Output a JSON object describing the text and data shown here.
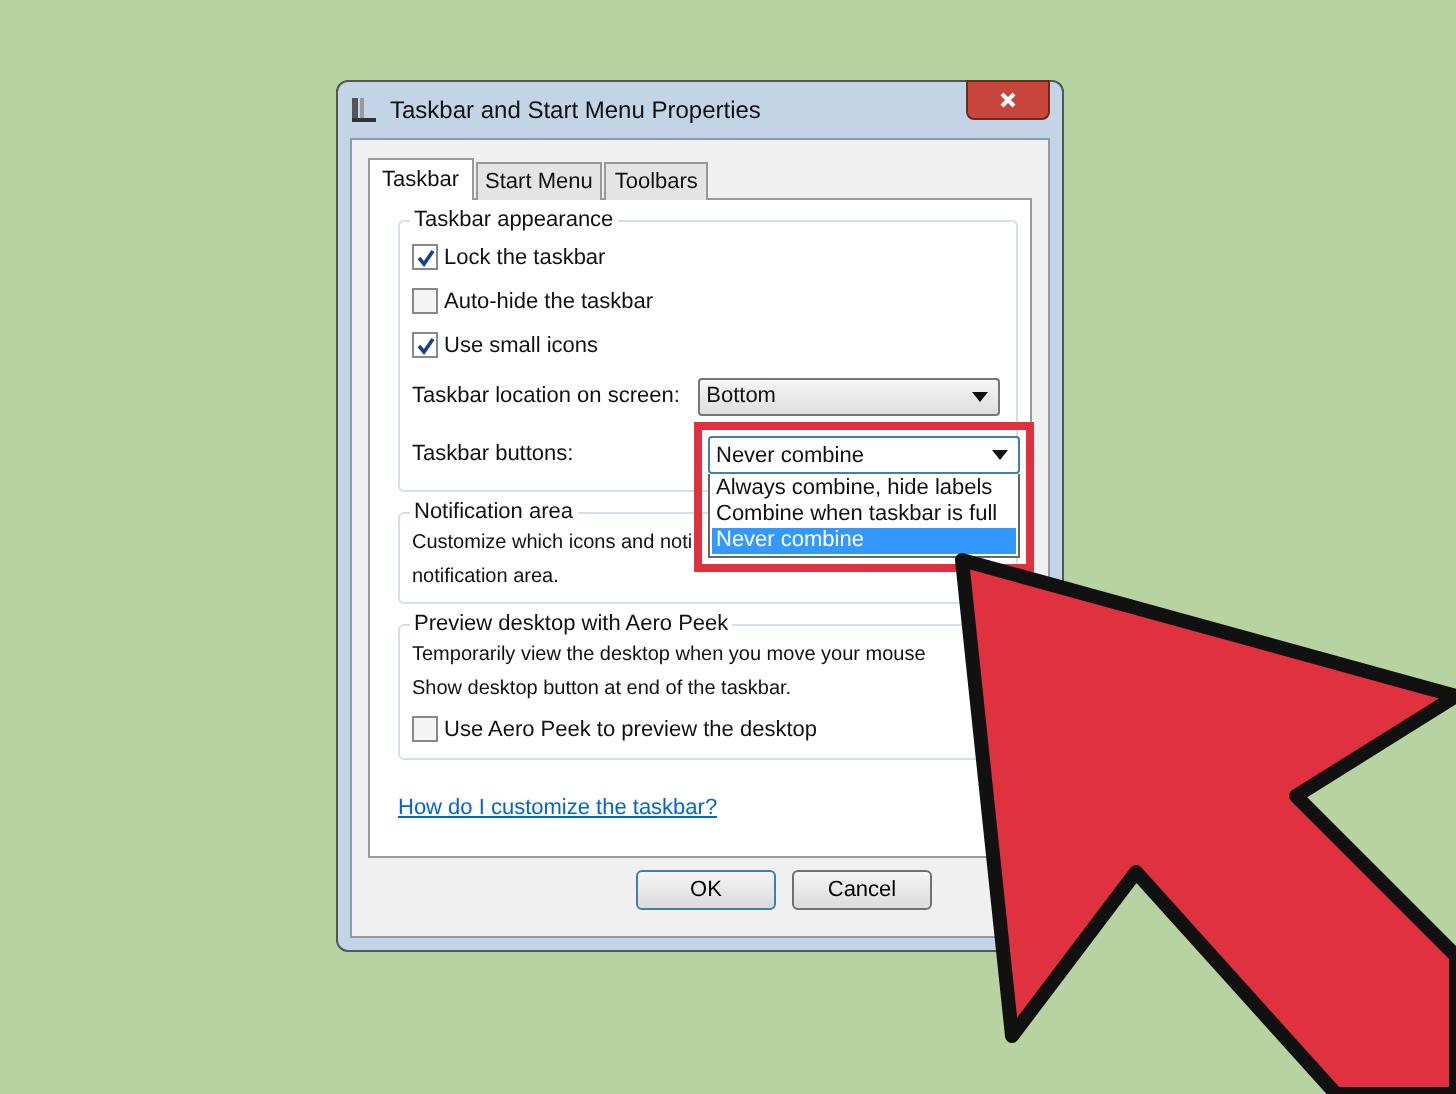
{
  "window": {
    "title": "Taskbar and Start Menu Properties"
  },
  "tabs": [
    {
      "label": "Taskbar",
      "selected": true
    },
    {
      "label": "Start Menu",
      "selected": false
    },
    {
      "label": "Toolbars",
      "selected": false
    }
  ],
  "appearance": {
    "title": "Taskbar appearance",
    "checkboxes": [
      {
        "label": "Lock the taskbar",
        "checked": true
      },
      {
        "label": "Auto-hide the taskbar",
        "checked": false
      },
      {
        "label": "Use small icons",
        "checked": true
      }
    ],
    "dropdowns": [
      {
        "label": "Taskbar location on screen:",
        "value": "Bottom",
        "open": false
      },
      {
        "label": "Taskbar buttons:",
        "value": "Never combine",
        "open": true,
        "highlighted": true,
        "options": [
          {
            "label": "Always combine, hide labels",
            "selected": false
          },
          {
            "label": "Combine when taskbar is full",
            "selected": false
          },
          {
            "label": "Never combine",
            "selected": true
          }
        ]
      }
    ]
  },
  "notification": {
    "title": "Notification area",
    "lines": [
      "Customize which icons and noti",
      "notification area."
    ]
  },
  "aero_peek": {
    "title": "Preview desktop with Aero Peek",
    "lines": [
      "Temporarily view the desktop when you move your mouse",
      "Show desktop button at end of the taskbar."
    ],
    "checkbox": {
      "label": "Use Aero Peek to preview the desktop",
      "checked": false
    }
  },
  "help_link": "How do I customize the taskbar?",
  "buttons": [
    {
      "label": "OK",
      "default": true
    },
    {
      "label": "Cancel",
      "default": false
    }
  ]
}
